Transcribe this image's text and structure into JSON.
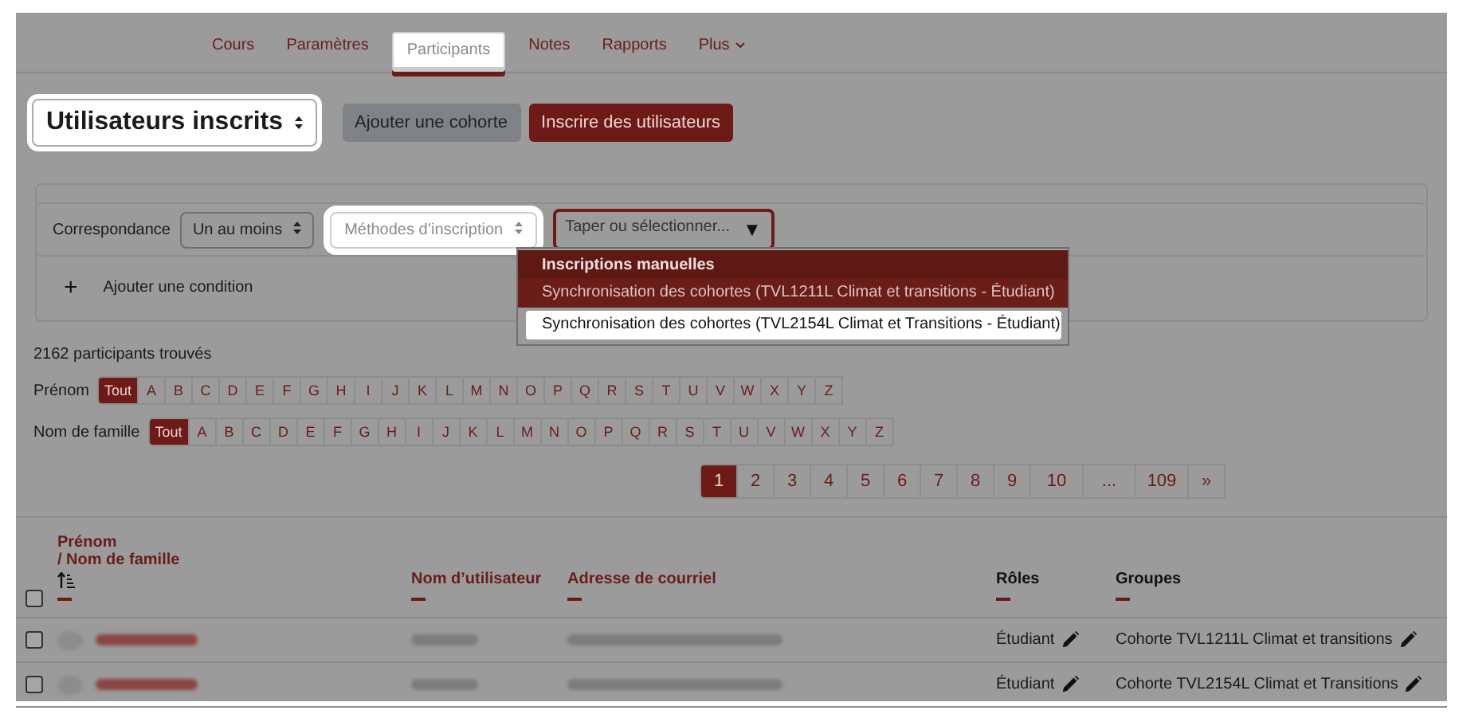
{
  "tabs": [
    {
      "label": "Cours",
      "selected": false,
      "spotlight": false
    },
    {
      "label": "Paramètres",
      "selected": false,
      "spotlight": false
    },
    {
      "label": "Participants",
      "selected": true,
      "spotlight": true
    },
    {
      "label": "Notes",
      "selected": false,
      "spotlight": false
    },
    {
      "label": "Rapports",
      "selected": false,
      "spotlight": false
    },
    {
      "label": "Plus",
      "selected": false,
      "spotlight": false,
      "kind": "menu"
    }
  ],
  "page_select": {
    "value": "Utilisateurs inscrits",
    "spotlight": true
  },
  "buttons": [
    {
      "label": "Ajouter une cohorte",
      "kind": "secondary"
    },
    {
      "label": "Inscrire des utilisateurs",
      "kind": "primary"
    }
  ],
  "filter": {
    "match_label": "Correspondance",
    "match_value": "Un au moins",
    "type_select": {
      "placeholder": "Méthodes d’inscription",
      "spotlight": true
    },
    "value_field": {
      "placeholder": "Taper ou sélectionner...",
      "arrow": "▼"
    },
    "dropdown": {
      "group": "Inscriptions manuelles",
      "options": [
        {
          "label": "Synchronisation des cohortes (TVL1211L Climat et transitions - Étudiant)",
          "selected": true,
          "spotlight": false
        },
        {
          "label": "Synchronisation des cohortes (TVL2154L Climat et Transitions - Étudiant)",
          "selected": false,
          "spotlight": true
        }
      ]
    },
    "add_condition": {
      "icon": "+",
      "label": "Ajouter une condition"
    }
  },
  "count": "2162 participants trouvés",
  "initials": [
    {
      "label": "Prénom",
      "letters": [
        {
          "label": "Tout",
          "selected": true
        },
        {
          "label": "A",
          "selected": false
        },
        {
          "label": "B",
          "selected": false
        },
        {
          "label": "C",
          "selected": false
        },
        {
          "label": "D",
          "selected": false
        },
        {
          "label": "E",
          "selected": false
        },
        {
          "label": "F",
          "selected": false
        },
        {
          "label": "G",
          "selected": false
        },
        {
          "label": "H",
          "selected": false
        },
        {
          "label": "I",
          "selected": false
        },
        {
          "label": "J",
          "selected": false
        },
        {
          "label": "K",
          "selected": false
        },
        {
          "label": "L",
          "selected": false
        },
        {
          "label": "M",
          "selected": false
        },
        {
          "label": "N",
          "selected": false
        },
        {
          "label": "O",
          "selected": false
        },
        {
          "label": "P",
          "selected": false
        },
        {
          "label": "Q",
          "selected": false
        },
        {
          "label": "R",
          "selected": false
        },
        {
          "label": "S",
          "selected": false
        },
        {
          "label": "T",
          "selected": false
        },
        {
          "label": "U",
          "selected": false
        },
        {
          "label": "V",
          "selected": false
        },
        {
          "label": "W",
          "selected": false
        },
        {
          "label": "X",
          "selected": false
        },
        {
          "label": "Y",
          "selected": false
        },
        {
          "label": "Z",
          "selected": false
        }
      ]
    },
    {
      "label": "Nom de famille",
      "letters": [
        {
          "label": "Tout",
          "selected": true
        },
        {
          "label": "A",
          "selected": false
        },
        {
          "label": "B",
          "selected": false
        },
        {
          "label": "C",
          "selected": false
        },
        {
          "label": "D",
          "selected": false
        },
        {
          "label": "E",
          "selected": false
        },
        {
          "label": "F",
          "selected": false
        },
        {
          "label": "G",
          "selected": false
        },
        {
          "label": "H",
          "selected": false
        },
        {
          "label": "I",
          "selected": false
        },
        {
          "label": "J",
          "selected": false
        },
        {
          "label": "K",
          "selected": false
        },
        {
          "label": "L",
          "selected": false
        },
        {
          "label": "M",
          "selected": false
        },
        {
          "label": "N",
          "selected": false
        },
        {
          "label": "O",
          "selected": false
        },
        {
          "label": "P",
          "selected": false
        },
        {
          "label": "Q",
          "selected": false
        },
        {
          "label": "R",
          "selected": false
        },
        {
          "label": "S",
          "selected": false
        },
        {
          "label": "T",
          "selected": false
        },
        {
          "label": "U",
          "selected": false
        },
        {
          "label": "V",
          "selected": false
        },
        {
          "label": "W",
          "selected": false
        },
        {
          "label": "X",
          "selected": false
        },
        {
          "label": "Y",
          "selected": false
        },
        {
          "label": "Z",
          "selected": false
        }
      ]
    }
  ],
  "pagination": [
    {
      "label": "1",
      "selected": true
    },
    {
      "label": "2",
      "selected": false
    },
    {
      "label": "3",
      "selected": false
    },
    {
      "label": "4",
      "selected": false
    },
    {
      "label": "5",
      "selected": false
    },
    {
      "label": "6",
      "selected": false
    },
    {
      "label": "7",
      "selected": false
    },
    {
      "label": "8",
      "selected": false
    },
    {
      "label": "9",
      "selected": false
    },
    {
      "label": "10",
      "selected": false
    },
    {
      "label": "...",
      "selected": false
    },
    {
      "label": "109",
      "selected": false
    },
    {
      "label": "»",
      "selected": false
    }
  ],
  "table": {
    "columns": [
      {
        "label": "Prénom",
        "label2": "/ Nom de famille"
      },
      {
        "label": "Nom d’utilisateur"
      },
      {
        "label": "Adresse de courriel"
      },
      {
        "label": "Rôles"
      },
      {
        "label": "Groupes"
      }
    ],
    "select_all": {
      "checked": false
    },
    "rows": [
      {
        "checked": false,
        "role": "Étudiant",
        "group": "Cohorte TVL1211L Climat et transitions"
      },
      {
        "checked": false,
        "role": "Étudiant",
        "group": "Cohorte TVL2154L Climat et Transitions"
      }
    ]
  }
}
